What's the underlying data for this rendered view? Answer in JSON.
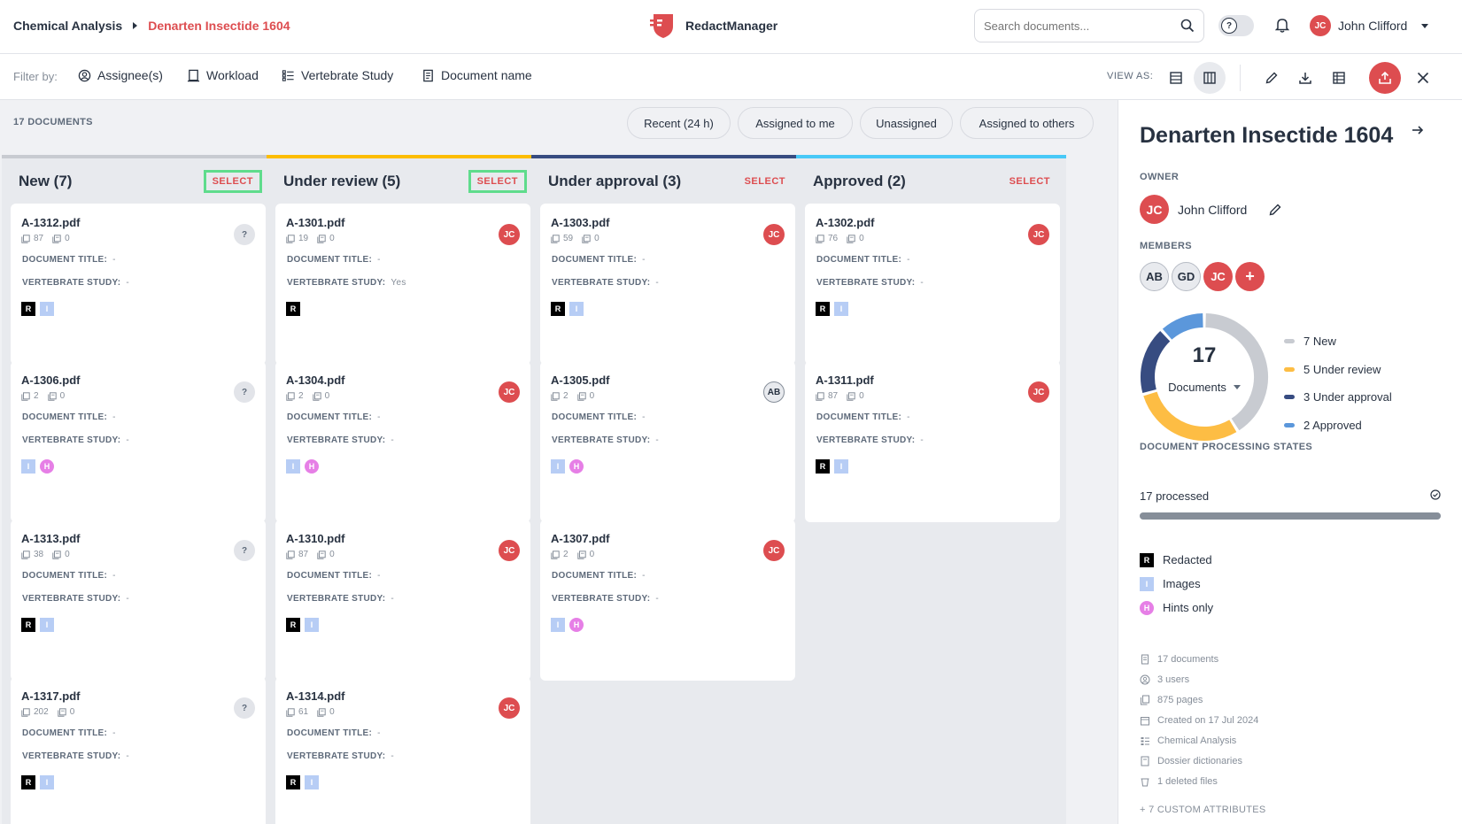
{
  "breadcrumb": {
    "parent": "Chemical Analysis",
    "current": "Denarten Insectide 1604"
  },
  "brand": {
    "name": "RedactManager",
    "color": "#dd4d50"
  },
  "search": {
    "placeholder": "Search documents..."
  },
  "user": {
    "initials": "JC",
    "name": "John Clifford"
  },
  "filters": {
    "label": "Filter by:",
    "items": [
      "Assignee(s)",
      "Workload",
      "Vertebrate Study",
      "Document name"
    ]
  },
  "view": {
    "label": "VIEW AS:"
  },
  "board": {
    "count_label": "17 DOCUMENTS",
    "quick_filters": [
      "Recent (24 h)",
      "Assigned to me",
      "Unassigned",
      "Assigned to others"
    ],
    "meta_labels": {
      "title": "DOCUMENT TITLE:",
      "study": "VERTEBRATE STUDY:"
    },
    "select_label": "SELECT",
    "columns": [
      {
        "title": "New (7)",
        "color": "#c8cbd1",
        "cards": [
          {
            "name": "A-1312.pdf",
            "pages": "87",
            "files": "0",
            "title": "-",
            "study": "-",
            "owner": "?",
            "badges": [
              "R",
              "I"
            ]
          },
          {
            "name": "A-1306.pdf",
            "pages": "2",
            "files": "0",
            "title": "-",
            "study": "-",
            "owner": "?",
            "badges": [
              "I",
              "H"
            ]
          },
          {
            "name": "A-1313.pdf",
            "pages": "38",
            "files": "0",
            "title": "-",
            "study": "-",
            "owner": "?",
            "badges": [
              "R",
              "I"
            ]
          },
          {
            "name": "A-1317.pdf",
            "pages": "202",
            "files": "0",
            "title": "-",
            "study": "-",
            "owner": "?",
            "badges": [
              "R",
              "I"
            ]
          }
        ]
      },
      {
        "title": "Under review (5)",
        "color": "#fdbd00",
        "cards": [
          {
            "name": "A-1301.pdf",
            "pages": "19",
            "files": "0",
            "title": "-",
            "study": "Yes",
            "owner": "JC",
            "badges": [
              "R"
            ]
          },
          {
            "name": "A-1304.pdf",
            "pages": "2",
            "files": "0",
            "title": "-",
            "study": "-",
            "owner": "JC",
            "badges": [
              "I",
              "H"
            ]
          },
          {
            "name": "A-1310.pdf",
            "pages": "87",
            "files": "0",
            "title": "-",
            "study": "-",
            "owner": "JC",
            "badges": [
              "R",
              "I"
            ]
          },
          {
            "name": "A-1314.pdf",
            "pages": "61",
            "files": "0",
            "title": "-",
            "study": "-",
            "owner": "JC",
            "badges": [
              "R",
              "I"
            ]
          }
        ]
      },
      {
        "title": "Under approval (3)",
        "color": "#374C81",
        "cards": [
          {
            "name": "A-1303.pdf",
            "pages": "59",
            "files": "0",
            "title": "-",
            "study": "-",
            "owner": "JC",
            "badges": [
              "R",
              "I"
            ]
          },
          {
            "name": "A-1305.pdf",
            "pages": "2",
            "files": "0",
            "title": "-",
            "study": "-",
            "owner": "AB",
            "badges": [
              "I",
              "H"
            ]
          },
          {
            "name": "A-1307.pdf",
            "pages": "2",
            "files": "0",
            "title": "-",
            "study": "-",
            "owner": "JC",
            "badges": [
              "I",
              "H"
            ]
          }
        ]
      },
      {
        "title": "Approved (2)",
        "color": "#48C9F7",
        "cards": [
          {
            "name": "A-1302.pdf",
            "pages": "76",
            "files": "0",
            "title": "-",
            "study": "-",
            "owner": "JC",
            "badges": [
              "R",
              "I"
            ]
          },
          {
            "name": "A-1311.pdf",
            "pages": "87",
            "files": "0",
            "title": "-",
            "study": "-",
            "owner": "JC",
            "badges": [
              "R",
              "I"
            ]
          }
        ]
      }
    ]
  },
  "panel": {
    "title": "Denarten Insectide 1604",
    "owner_label": "OWNER",
    "owner": {
      "initials": "JC",
      "name": "John Clifford"
    },
    "members_label": "MEMBERS",
    "members": [
      "AB",
      "GD",
      "JC"
    ],
    "add_member": "+",
    "donut": {
      "total": "17",
      "unit": "Documents",
      "segments": [
        {
          "label": "7 New",
          "value": 7,
          "color": "#c8cbd1"
        },
        {
          "label": "5 Under review",
          "value": 5,
          "color": "#fdbd44"
        },
        {
          "label": "3 Under approval",
          "value": 3,
          "color": "#374C81"
        },
        {
          "label": "2 Approved",
          "value": 2,
          "color": "#5b97db"
        }
      ]
    },
    "processing_label": "DOCUMENT PROCESSING STATES",
    "processed": "17 processed",
    "processed_fraction": 1.0,
    "legend": [
      {
        "badge": "R",
        "label": "Redacted"
      },
      {
        "badge": "I",
        "label": "Images"
      },
      {
        "badge": "H",
        "label": "Hints only"
      }
    ],
    "info": [
      {
        "icon": "document-icon",
        "text": "17 documents"
      },
      {
        "icon": "users-icon",
        "text": "3 users"
      },
      {
        "icon": "pages-icon",
        "text": "875 pages"
      },
      {
        "icon": "calendar-icon",
        "text": "Created on 17 Jul 2024"
      },
      {
        "icon": "template-icon",
        "text": "Chemical Analysis"
      },
      {
        "icon": "dictionary-icon",
        "text": "Dossier dictionaries"
      },
      {
        "icon": "trash-icon",
        "text": "1 deleted files"
      }
    ],
    "custom_attributes": "+ 7 CUSTOM ATTRIBUTES"
  }
}
